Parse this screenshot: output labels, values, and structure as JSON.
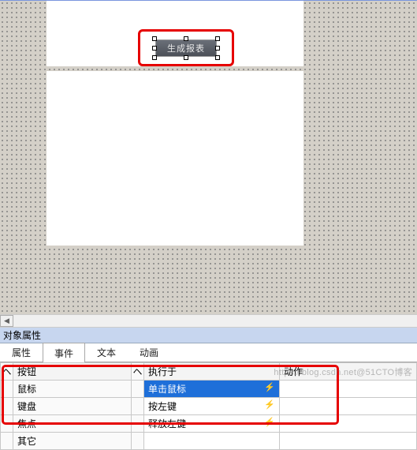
{
  "designer": {
    "button_label": "生成报表"
  },
  "panel": {
    "title": "对象属性"
  },
  "tabs": [
    "属性",
    "事件",
    "文本",
    "动画"
  ],
  "active_tab_index": 1,
  "grid": {
    "headers": {
      "category": "按钮",
      "trigger": "执行于",
      "action": "动作"
    },
    "rows": [
      {
        "category": "鼠标",
        "trigger": "单击鼠标",
        "selected": true
      },
      {
        "category": "键盘",
        "trigger": "按左键",
        "selected": false
      },
      {
        "category": "焦点",
        "trigger": "释放左键",
        "selected": false
      },
      {
        "category": "其它",
        "trigger": "",
        "selected": false
      }
    ],
    "expand_glyph": "ヘ"
  },
  "watermark": "https://blog.csdn.net@51CTO博客"
}
